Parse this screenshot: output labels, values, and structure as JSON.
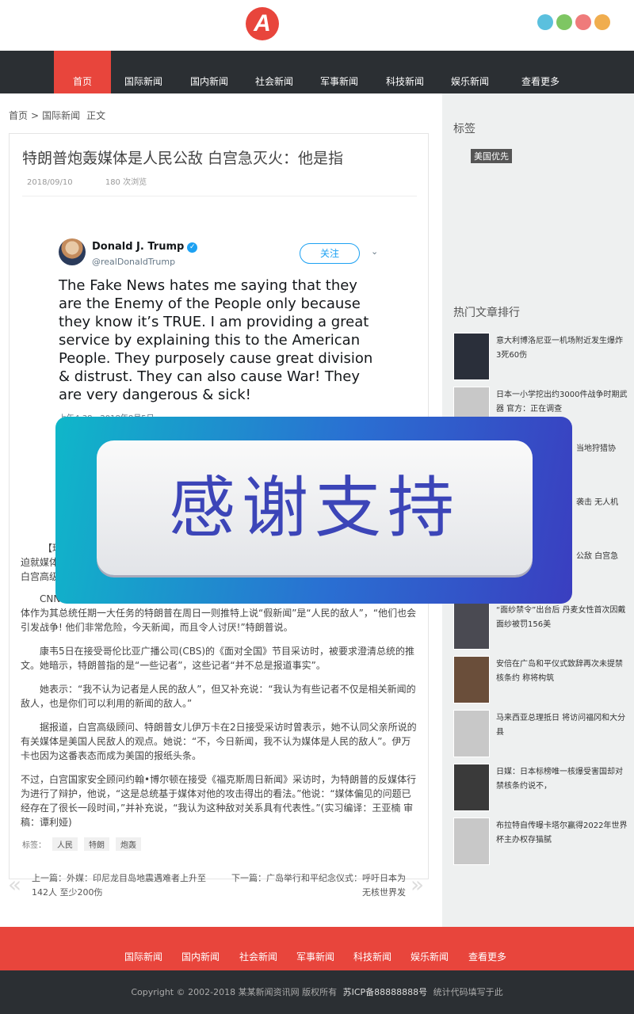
{
  "header": {
    "logo_letter": "A",
    "social": [
      {
        "icon": "qq-icon",
        "glyph": "",
        "color": "#5bc0de"
      },
      {
        "icon": "wechat-icon",
        "glyph": "",
        "color": "#7ec663"
      },
      {
        "icon": "weibo-icon",
        "glyph": "",
        "color": "#ef7b7b"
      },
      {
        "icon": "rss-icon",
        "glyph": "",
        "color": "#f0ad4e"
      }
    ],
    "menu_glyph": ""
  },
  "nav": {
    "items": [
      {
        "icon": "",
        "label": "首页"
      },
      {
        "icon": "",
        "label": "国际新闻"
      },
      {
        "icon": "",
        "label": "国内新闻"
      },
      {
        "icon": "",
        "label": "社会新闻"
      },
      {
        "icon": "",
        "label": "军事新闻"
      },
      {
        "icon": "",
        "label": "科技新闻"
      },
      {
        "icon": "",
        "label": "娱乐新闻"
      },
      {
        "icon": "",
        "label": "查看更多 "
      }
    ]
  },
  "breadcrumb": {
    "home": "首页",
    "sep": ">",
    "section": "国际新闻",
    "icon": "",
    "current": "正文"
  },
  "article": {
    "title": "特朗普炮轰媒体是人民公敌 白宫急灭火：他是指",
    "date_icon": "",
    "date": "2018/09/10",
    "comment_icon": "",
    "views_icon": "",
    "views": "180 次浏览",
    "tweet": {
      "name": "Donald J. Trump",
      "verified": "✓",
      "handle": "@realDonaldTrump",
      "follow": "关注",
      "chevron": "⌄",
      "text": "The Fake News hates me saying that they are the Enemy of the People only because they know it’s TRUE. I am providing a great service by explaining this to the American People. They purposely cause great division & distrust. They can also cause War! They are very dangerous & sick!",
      "date": "上午4:38 - 2018年8月5日"
    },
    "p1a": "【环",
    "p1b": "迫就媒体",
    "p1c": "白宫高级",
    "p2a": "CNN",
    "p2b": "体作为其总统任期一大任务的特朗普在周日一则推特上说“假新闻”是“人民的敌人”，“他们也会引发战争! 他们非常危险，今天新闻，而且令人讨厌!”特朗普说。",
    "p3": "康韦5日在接受哥伦比亚广播公司(CBS)的《面对全国》节目采访时，被要求澄清总统的推文。她暗示，特朗普指的是“一些记者”，这些记者“并不总是报道事实”。",
    "p4": "她表示：“我不认为记者是人民的敌人”，但又补充说：“我认为有些记者不仅是相关新闻的敌人，也是你们可以利用的新闻的敌人。”",
    "p5": "据报道，白宫高级顾问、特朗普女儿伊万卡在2日接受采访时曾表示，她不认同父亲所说的有关媒体是美国人民敌人的观点。她说：“不，今日新闻，我不认为媒体是人民的敌人”。伊万卡也因为这番表态而成为美国的报纸头条。",
    "p6": "不过，白宫国家安全顾问约翰•博尔顿在接受《福克斯周日新闻》采访时，为特朗普的反媒体行为进行了辩护，他说，“这是总统基于媒体对他的攻击得出的看法。”他说：“媒体偏见的问题已经存在了很长一段时间，”并补充说，“我认为这种敌对关系具有代表性。”(实习编译：王亚楠 审稿：谭利娅)",
    "tags_label": "标签：",
    "tags": [
      "人民",
      "特朗",
      "炮轰"
    ]
  },
  "prevnext": {
    "prev_arrow": "«",
    "prev": "上一篇：外媒：印尼龙目岛地震遇难者上升至142人 至少200伤",
    "next": "下一篇：广岛举行和平纪念仪式：呼吁日本为无核世界发",
    "next_arrow": "»"
  },
  "sidebar": {
    "tags_heading": "标签",
    "tag": "美国优先",
    "hot_heading": "热门文章排行",
    "hot": [
      {
        "title": "意大利博洛尼亚一机场附近发生爆炸 3死60伤",
        "thumb": "#2a2f3a"
      },
      {
        "title": "日本一小学挖出约3000件战争时期武器 官方：正在调查",
        "thumb": "#c3c3c3"
      },
      {
        "title": "当地狩猎协",
        "thumb": "#c3c3c3"
      },
      {
        "title": "袭击 无人机",
        "thumb": "#c3c3c3"
      },
      {
        "title": "公敌 白宫急",
        "thumb": "#c3c3c3"
      },
      {
        "title": "“面纱禁令”出台后 丹麦女性首次因戴面纱被罚156美",
        "thumb": "#4a4a52"
      },
      {
        "title": "安倍在广岛和平仪式致辞再次未提禁核条约 称将构筑",
        "thumb": "#6a4e3a"
      },
      {
        "title": "马来西亚总理抵日 将访问福冈和大分县",
        "thumb": "#c3c3c3"
      },
      {
        "title": "日媒：日本标榜唯一核爆受害国却对禁核条约说不，",
        "thumb": "#3a3a3a"
      },
      {
        "title": "布拉特自传曝卡塔尔赢得2022年世界杯主办权存猫腻",
        "thumb": "#c3c3c3"
      }
    ]
  },
  "footer_nav": {
    "items": [
      {
        "icon": "",
        "label": "国际新闻"
      },
      {
        "icon": "",
        "label": "国内新闻"
      },
      {
        "icon": "",
        "label": "社会新闻"
      },
      {
        "icon": "",
        "label": "军事新闻"
      },
      {
        "icon": "",
        "label": "科技新闻"
      },
      {
        "icon": "",
        "label": "娱乐新闻"
      },
      {
        "icon": "",
        "label": "查看更多 "
      }
    ]
  },
  "footer": {
    "copyright": "Copyright © 2002-2018 某某新闻资讯网 版权所有",
    "icp": "苏ICP备88888888号",
    "stats": "统计代码填写于此"
  },
  "overlay": {
    "text": "感谢支持"
  }
}
